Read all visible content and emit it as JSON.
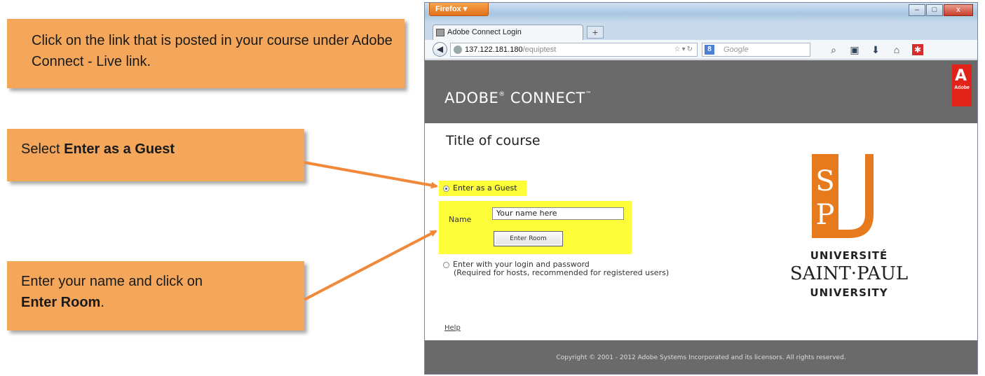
{
  "callouts": {
    "step1": "Click on the link that is posted in your course under Adobe Connect - Live link.",
    "step2_prefix": "Select ",
    "step2_bold": "Enter as a Guest",
    "step3_prefix": "Enter your name and click on ",
    "step3_bold": "Enter Room",
    "step3_suffix": "."
  },
  "browser": {
    "app_button": "Firefox",
    "tab_title": "Adobe Connect Login",
    "new_tab": "+",
    "url_host": "137.122.181.180",
    "url_path": "/equiptest",
    "search_placeholder": "Google",
    "search_engine_icon": "google-icon",
    "controls": {
      "minimize": "–",
      "maximize": "□",
      "close": "x"
    }
  },
  "page": {
    "logo_text": "ADOBE",
    "logo_reg": "®",
    "logo_text2": " CONNECT",
    "logo_tm": "™",
    "adobe_badge": "Adobe",
    "course_title": "Title of course",
    "guest_option": "Enter as a Guest",
    "name_label": "Name",
    "name_value": "Your name here",
    "enter_room": "Enter Room",
    "login_option": "Enter with your login and password",
    "login_sub": "(Required for hosts, recommended for registered users)",
    "help": "Help",
    "footer": "Copyright © 2001 - 2012 Adobe Systems Incorporated and its licensors. All rights reserved."
  },
  "spu": {
    "monogram_top": "S",
    "monogram_bottom": "P",
    "line1": "UNIVERSITÉ",
    "line2": "SAINT·PAUL",
    "line3": "UNIVERSITY"
  },
  "colors": {
    "callout": "#f4a75b",
    "arrow": "#f0893a",
    "highlight": "#fdfd3a",
    "spu_orange": "#e87a1e",
    "adobe_red": "#e2231a",
    "header_gray": "#6a6a6a"
  }
}
